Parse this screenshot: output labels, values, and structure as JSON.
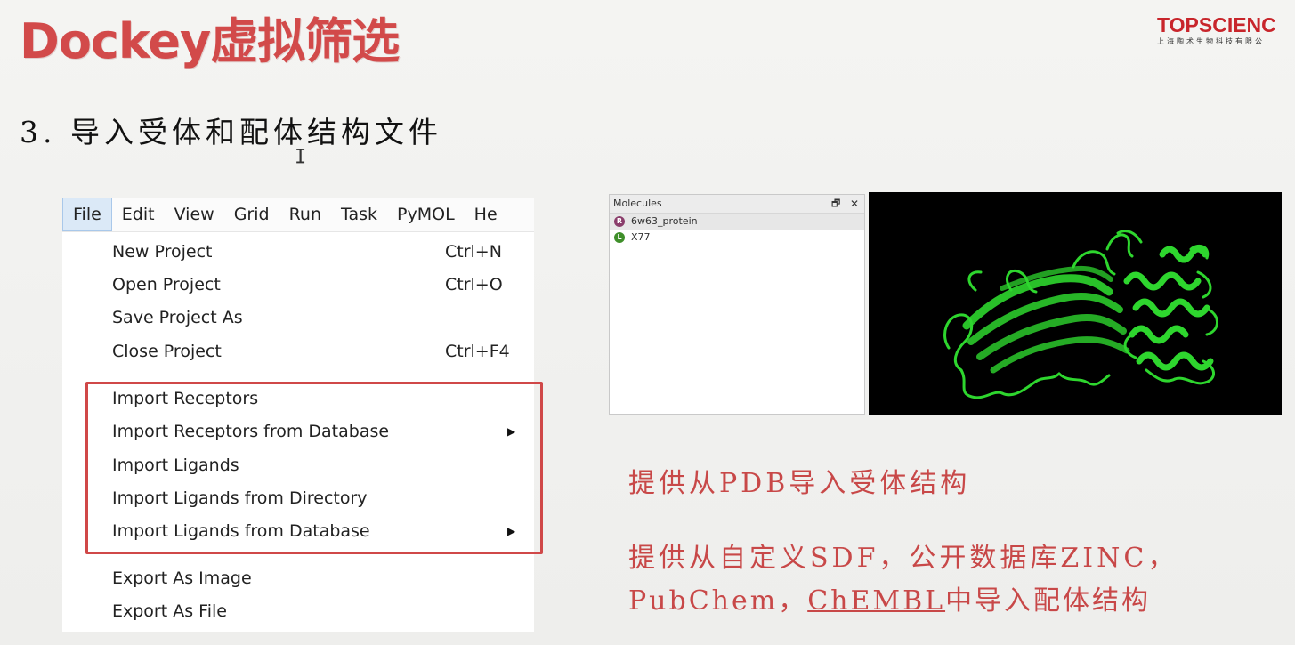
{
  "slide": {
    "title": "Dockey虚拟筛选",
    "step_heading": "3. 导入受体和配体结构文件"
  },
  "logo": {
    "brand": "TOPSCIENC",
    "subtitle": "上海陶术生物科技有限公"
  },
  "menubar": {
    "items": [
      "File",
      "Edit",
      "View",
      "Grid",
      "Run",
      "Task",
      "PyMOL",
      "He"
    ],
    "active": "File"
  },
  "file_menu": {
    "items": [
      {
        "label": "New Project",
        "shortcut": "Ctrl+N"
      },
      {
        "label": "Open Project",
        "shortcut": "Ctrl+O"
      },
      {
        "label": "Save Project As",
        "shortcut": ""
      },
      {
        "label": "Close Project",
        "shortcut": "Ctrl+F4"
      },
      {
        "label": "Import Receptors",
        "shortcut": ""
      },
      {
        "label": "Import Receptors from Database",
        "shortcut": "",
        "submenu": true
      },
      {
        "label": "Import Ligands",
        "shortcut": ""
      },
      {
        "label": "Import Ligands from Directory",
        "shortcut": ""
      },
      {
        "label": "Import Ligands from Database",
        "shortcut": "",
        "submenu": true
      },
      {
        "label": "Export As Image",
        "shortcut": ""
      },
      {
        "label": "Export As File",
        "shortcut": ""
      }
    ],
    "submenu_arrow": "▶"
  },
  "molecules_panel": {
    "title": "Molecules",
    "float_button": "🗗",
    "close_button": "✕",
    "items": [
      {
        "badge": "R",
        "name": "6w63_protein",
        "badge_color": "#8a3d6b"
      },
      {
        "badge": "L",
        "name": "X77",
        "badge_color": "#3f8f2a"
      }
    ]
  },
  "viewer": {
    "ribbon_color": "#2ed62e",
    "background": "#000000"
  },
  "annotations": {
    "receptor_note": "提供从PDB导入受体结构",
    "ligand_note_line1": "提供从自定义SDF，公开数据库ZINC，",
    "ligand_note_line2_a": "PubChem，",
    "ligand_note_line2_b": "ChEMBL",
    "ligand_note_line2_c": "中导入配体结构"
  },
  "colors": {
    "title": "#d24a4a",
    "logo": "#c8252b",
    "highlight_box": "#d04848",
    "annotation": "#c84848"
  }
}
